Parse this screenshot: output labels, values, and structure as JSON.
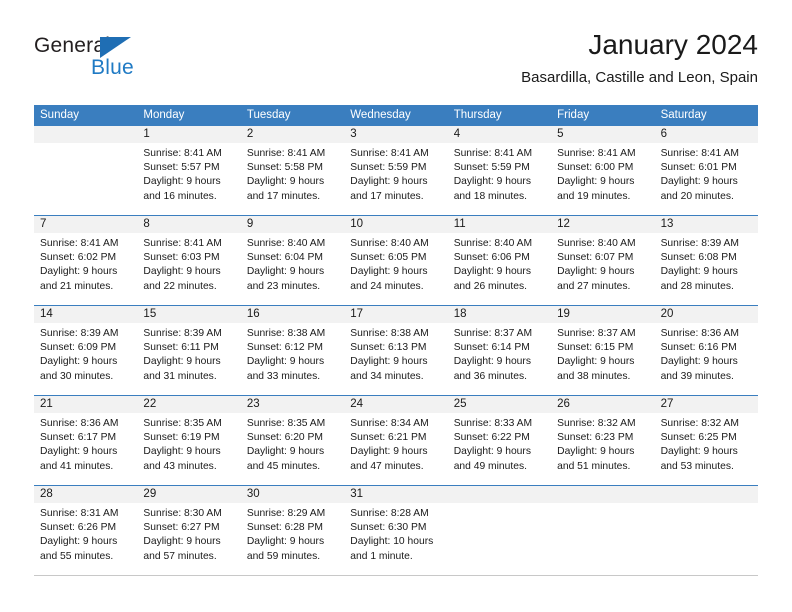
{
  "brand": {
    "name_dark": "General",
    "name_blue": "Blue",
    "triangle_icon": "brand-triangle-icon",
    "accent_color": "#1f6eb4"
  },
  "header": {
    "title": "January 2024",
    "subtitle": "Basardilla, Castille and Leon, Spain"
  },
  "calendar": {
    "header_bg": "#3a7ebf",
    "header_text_color": "#ffffff",
    "daynum_band_bg": "#f2f2f2",
    "weekday_names": [
      "Sunday",
      "Monday",
      "Tuesday",
      "Wednesday",
      "Thursday",
      "Friday",
      "Saturday"
    ],
    "weeks": [
      [
        {
          "day": "",
          "lines": []
        },
        {
          "day": "1",
          "lines": [
            "Sunrise: 8:41 AM",
            "Sunset: 5:57 PM",
            "Daylight: 9 hours",
            "and 16 minutes."
          ]
        },
        {
          "day": "2",
          "lines": [
            "Sunrise: 8:41 AM",
            "Sunset: 5:58 PM",
            "Daylight: 9 hours",
            "and 17 minutes."
          ]
        },
        {
          "day": "3",
          "lines": [
            "Sunrise: 8:41 AM",
            "Sunset: 5:59 PM",
            "Daylight: 9 hours",
            "and 17 minutes."
          ]
        },
        {
          "day": "4",
          "lines": [
            "Sunrise: 8:41 AM",
            "Sunset: 5:59 PM",
            "Daylight: 9 hours",
            "and 18 minutes."
          ]
        },
        {
          "day": "5",
          "lines": [
            "Sunrise: 8:41 AM",
            "Sunset: 6:00 PM",
            "Daylight: 9 hours",
            "and 19 minutes."
          ]
        },
        {
          "day": "6",
          "lines": [
            "Sunrise: 8:41 AM",
            "Sunset: 6:01 PM",
            "Daylight: 9 hours",
            "and 20 minutes."
          ]
        }
      ],
      [
        {
          "day": "7",
          "lines": [
            "Sunrise: 8:41 AM",
            "Sunset: 6:02 PM",
            "Daylight: 9 hours",
            "and 21 minutes."
          ]
        },
        {
          "day": "8",
          "lines": [
            "Sunrise: 8:41 AM",
            "Sunset: 6:03 PM",
            "Daylight: 9 hours",
            "and 22 minutes."
          ]
        },
        {
          "day": "9",
          "lines": [
            "Sunrise: 8:40 AM",
            "Sunset: 6:04 PM",
            "Daylight: 9 hours",
            "and 23 minutes."
          ]
        },
        {
          "day": "10",
          "lines": [
            "Sunrise: 8:40 AM",
            "Sunset: 6:05 PM",
            "Daylight: 9 hours",
            "and 24 minutes."
          ]
        },
        {
          "day": "11",
          "lines": [
            "Sunrise: 8:40 AM",
            "Sunset: 6:06 PM",
            "Daylight: 9 hours",
            "and 26 minutes."
          ]
        },
        {
          "day": "12",
          "lines": [
            "Sunrise: 8:40 AM",
            "Sunset: 6:07 PM",
            "Daylight: 9 hours",
            "and 27 minutes."
          ]
        },
        {
          "day": "13",
          "lines": [
            "Sunrise: 8:39 AM",
            "Sunset: 6:08 PM",
            "Daylight: 9 hours",
            "and 28 minutes."
          ]
        }
      ],
      [
        {
          "day": "14",
          "lines": [
            "Sunrise: 8:39 AM",
            "Sunset: 6:09 PM",
            "Daylight: 9 hours",
            "and 30 minutes."
          ]
        },
        {
          "day": "15",
          "lines": [
            "Sunrise: 8:39 AM",
            "Sunset: 6:11 PM",
            "Daylight: 9 hours",
            "and 31 minutes."
          ]
        },
        {
          "day": "16",
          "lines": [
            "Sunrise: 8:38 AM",
            "Sunset: 6:12 PM",
            "Daylight: 9 hours",
            "and 33 minutes."
          ]
        },
        {
          "day": "17",
          "lines": [
            "Sunrise: 8:38 AM",
            "Sunset: 6:13 PM",
            "Daylight: 9 hours",
            "and 34 minutes."
          ]
        },
        {
          "day": "18",
          "lines": [
            "Sunrise: 8:37 AM",
            "Sunset: 6:14 PM",
            "Daylight: 9 hours",
            "and 36 minutes."
          ]
        },
        {
          "day": "19",
          "lines": [
            "Sunrise: 8:37 AM",
            "Sunset: 6:15 PM",
            "Daylight: 9 hours",
            "and 38 minutes."
          ]
        },
        {
          "day": "20",
          "lines": [
            "Sunrise: 8:36 AM",
            "Sunset: 6:16 PM",
            "Daylight: 9 hours",
            "and 39 minutes."
          ]
        }
      ],
      [
        {
          "day": "21",
          "lines": [
            "Sunrise: 8:36 AM",
            "Sunset: 6:17 PM",
            "Daylight: 9 hours",
            "and 41 minutes."
          ]
        },
        {
          "day": "22",
          "lines": [
            "Sunrise: 8:35 AM",
            "Sunset: 6:19 PM",
            "Daylight: 9 hours",
            "and 43 minutes."
          ]
        },
        {
          "day": "23",
          "lines": [
            "Sunrise: 8:35 AM",
            "Sunset: 6:20 PM",
            "Daylight: 9 hours",
            "and 45 minutes."
          ]
        },
        {
          "day": "24",
          "lines": [
            "Sunrise: 8:34 AM",
            "Sunset: 6:21 PM",
            "Daylight: 9 hours",
            "and 47 minutes."
          ]
        },
        {
          "day": "25",
          "lines": [
            "Sunrise: 8:33 AM",
            "Sunset: 6:22 PM",
            "Daylight: 9 hours",
            "and 49 minutes."
          ]
        },
        {
          "day": "26",
          "lines": [
            "Sunrise: 8:32 AM",
            "Sunset: 6:23 PM",
            "Daylight: 9 hours",
            "and 51 minutes."
          ]
        },
        {
          "day": "27",
          "lines": [
            "Sunrise: 8:32 AM",
            "Sunset: 6:25 PM",
            "Daylight: 9 hours",
            "and 53 minutes."
          ]
        }
      ],
      [
        {
          "day": "28",
          "lines": [
            "Sunrise: 8:31 AM",
            "Sunset: 6:26 PM",
            "Daylight: 9 hours",
            "and 55 minutes."
          ]
        },
        {
          "day": "29",
          "lines": [
            "Sunrise: 8:30 AM",
            "Sunset: 6:27 PM",
            "Daylight: 9 hours",
            "and 57 minutes."
          ]
        },
        {
          "day": "30",
          "lines": [
            "Sunrise: 8:29 AM",
            "Sunset: 6:28 PM",
            "Daylight: 9 hours",
            "and 59 minutes."
          ]
        },
        {
          "day": "31",
          "lines": [
            "Sunrise: 8:28 AM",
            "Sunset: 6:30 PM",
            "Daylight: 10 hours",
            "and 1 minute."
          ]
        },
        {
          "day": "",
          "lines": []
        },
        {
          "day": "",
          "lines": []
        },
        {
          "day": "",
          "lines": []
        }
      ]
    ]
  }
}
